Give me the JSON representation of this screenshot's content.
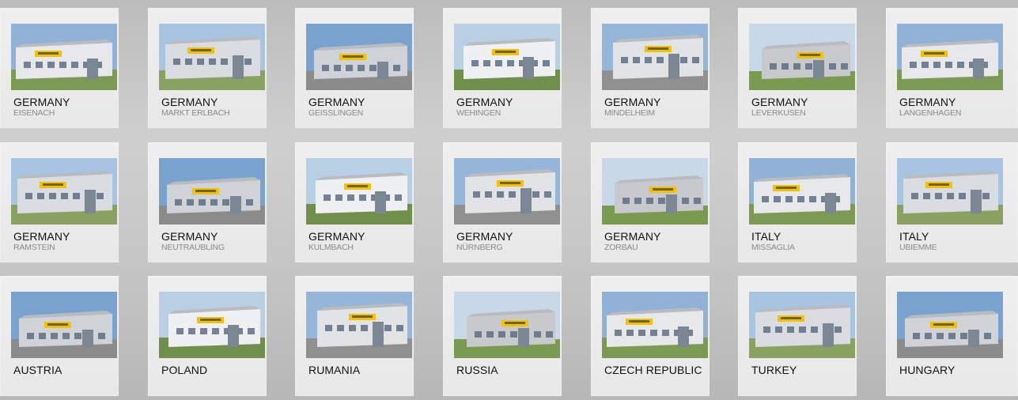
{
  "locations": [
    {
      "country": "GERMANY",
      "city": "EISENACH"
    },
    {
      "country": "GERMANY",
      "city": "MARKT ERLBACH"
    },
    {
      "country": "GERMANY",
      "city": "GEISSLINGEN"
    },
    {
      "country": "GERMANY",
      "city": "WEHINGEN"
    },
    {
      "country": "GERMANY",
      "city": "MINDELHEIM"
    },
    {
      "country": "GERMANY",
      "city": "LEVERKUSEN"
    },
    {
      "country": "GERMANY",
      "city": "LANGENHAGEN"
    },
    {
      "country": "GERMANY",
      "city": "RAMSTEIN"
    },
    {
      "country": "GERMANY",
      "city": "NEUTRAUBLING"
    },
    {
      "country": "GERMANY",
      "city": "KULMBACH"
    },
    {
      "country": "GERMANY",
      "city": "NÜRNBERG"
    },
    {
      "country": "GERMANY",
      "city": "ZORBAU"
    },
    {
      "country": "ITALY",
      "city": "MISSAGLIA"
    },
    {
      "country": "ITALY",
      "city": "UBIEMME"
    },
    {
      "country": "AUSTRIA",
      "city": ""
    },
    {
      "country": "POLAND",
      "city": ""
    },
    {
      "country": "RUMANIA",
      "city": ""
    },
    {
      "country": "RUSSIA",
      "city": ""
    },
    {
      "country": "CZECH REPUBLIC",
      "city": ""
    },
    {
      "country": "TURKEY",
      "city": ""
    },
    {
      "country": "HUNGARY",
      "city": ""
    }
  ],
  "colors": {
    "card_bg": "#ececec",
    "country_text": "#111111",
    "city_text": "#8a8a8a",
    "sign_yellow": "#f2c200"
  }
}
